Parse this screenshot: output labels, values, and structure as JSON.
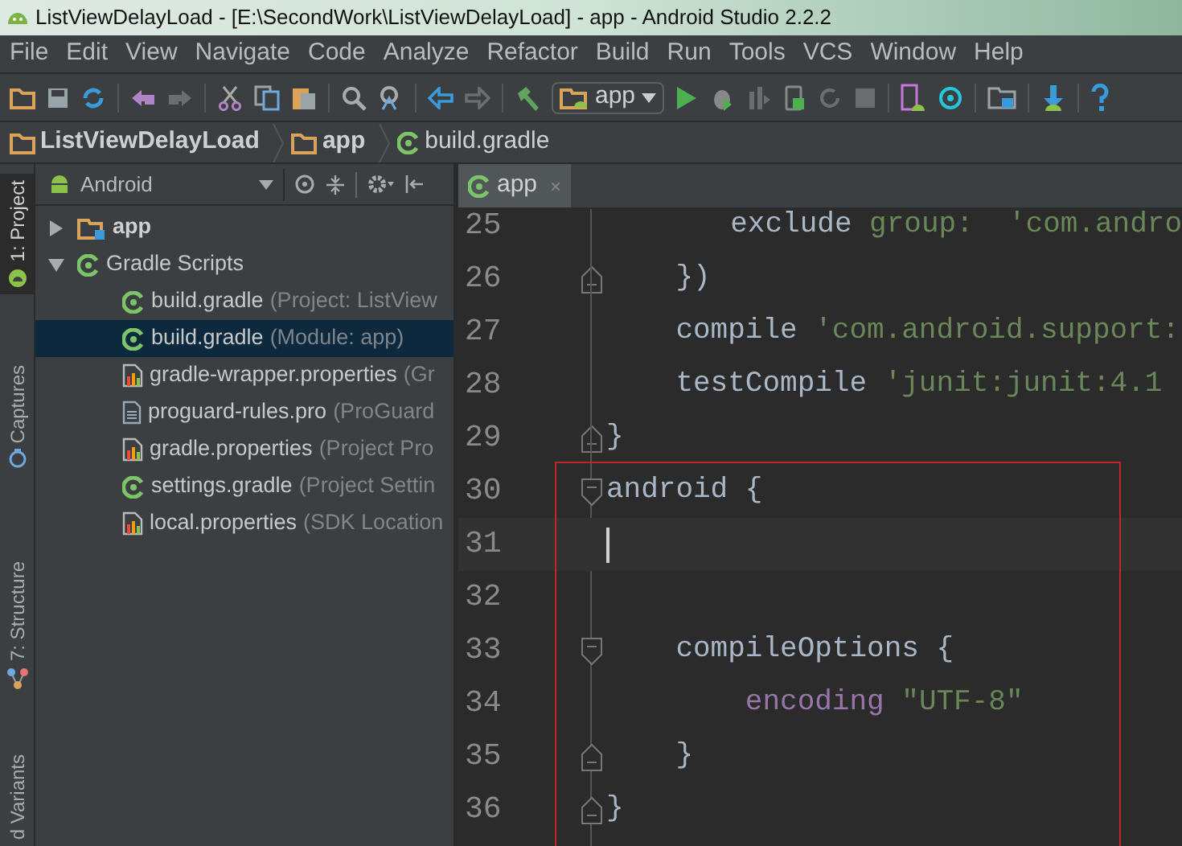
{
  "window": {
    "title": "ListViewDelayLoad - [E:\\SecondWork\\ListViewDelayLoad] - app - Android Studio 2.2.2"
  },
  "menu": [
    "File",
    "Edit",
    "View",
    "Navigate",
    "Code",
    "Analyze",
    "Refactor",
    "Build",
    "Run",
    "Tools",
    "VCS",
    "Window",
    "Help"
  ],
  "toolbar": {
    "run_configuration": "app"
  },
  "breadcrumbs": [
    {
      "label": "ListViewDelayLoad",
      "kind": "folder"
    },
    {
      "label": "app",
      "kind": "folder"
    },
    {
      "label": "build.gradle",
      "kind": "gradle"
    }
  ],
  "tool_strip": [
    {
      "label": "1: Project",
      "selected": true,
      "kind": "project"
    },
    {
      "label": "Captures",
      "selected": false,
      "kind": "captures"
    },
    {
      "label": "7: Structure",
      "selected": false,
      "kind": "structure"
    },
    {
      "label": "d Variants",
      "selected": false,
      "kind": "none"
    }
  ],
  "project_panel": {
    "view": "Android",
    "tree": [
      {
        "label": "app",
        "kind": "module",
        "expanded": false,
        "selected": false
      },
      {
        "label": "Gradle Scripts",
        "kind": "gradle",
        "expanded": true,
        "selected": false,
        "children": [
          {
            "label": "build.gradle",
            "detail": "(Project: ListView",
            "kind": "gradle",
            "selected": false
          },
          {
            "label": "build.gradle",
            "detail": "(Module: app)",
            "kind": "gradle",
            "selected": true
          },
          {
            "label": "gradle-wrapper.properties",
            "detail": "(Gr",
            "kind": "properties",
            "selected": false
          },
          {
            "label": "proguard-rules.pro",
            "detail": "(ProGuard",
            "kind": "text",
            "selected": false
          },
          {
            "label": "gradle.properties",
            "detail": "(Project Pro",
            "kind": "properties",
            "selected": false
          },
          {
            "label": "settings.gradle",
            "detail": "(Project Settin",
            "kind": "gradle",
            "selected": false
          },
          {
            "label": "local.properties",
            "detail": "(SDK Location",
            "kind": "properties",
            "selected": false
          }
        ]
      }
    ]
  },
  "editor": {
    "tabs": [
      {
        "label": "app",
        "close": "×",
        "selected": true
      }
    ],
    "lines": [
      {
        "number": "25",
        "fold_start": false,
        "fold_end": false,
        "current": false,
        "tokens": [
          {
            "text": "        exclude ",
            "kind": "plain"
          },
          {
            "text": "group: ",
            "kind": "named"
          },
          {
            "text": " 'com.andro",
            "kind": "string"
          }
        ]
      },
      {
        "number": "26",
        "fold_start": false,
        "fold_end": true,
        "current": false,
        "tokens": [
          {
            "text": "    })",
            "kind": "plain"
          }
        ]
      },
      {
        "number": "27",
        "fold_start": false,
        "fold_end": false,
        "current": false,
        "tokens": [
          {
            "text": "    compile ",
            "kind": "plain"
          },
          {
            "text": "'com.android.support:",
            "kind": "string"
          }
        ]
      },
      {
        "number": "28",
        "fold_start": false,
        "fold_end": false,
        "current": false,
        "tokens": [
          {
            "text": "    testCompile ",
            "kind": "plain"
          },
          {
            "text": "'junit:junit:4.1",
            "kind": "string"
          }
        ]
      },
      {
        "number": "29",
        "fold_start": false,
        "fold_end": true,
        "current": false,
        "tokens": [
          {
            "text": "}",
            "kind": "plain"
          }
        ]
      }
    ],
    "highlight_box": {
      "lines": [
        {
          "number": "30",
          "fold_start": true,
          "fold_end": false,
          "current": false,
          "tokens": [
            {
              "text": "android {",
              "kind": "plain"
            }
          ]
        },
        {
          "number": "31",
          "fold_start": false,
          "fold_end": false,
          "current": true
        },
        {
          "number": "32",
          "fold_start": false,
          "fold_end": false,
          "current": false
        },
        {
          "number": "33",
          "fold_start": true,
          "fold_end": false,
          "current": false,
          "tokens": [
            {
              "text": "    compileOptions {",
              "kind": "plain"
            }
          ]
        },
        {
          "number": "34",
          "fold_start": false,
          "fold_end": false,
          "current": false,
          "tokens": [
            {
              "text": "        encoding ",
              "kind": "keyword"
            },
            {
              "text": "\"UTF-8\"",
              "kind": "string"
            }
          ]
        },
        {
          "number": "35",
          "fold_start": false,
          "fold_end": true,
          "current": false,
          "tokens": [
            {
              "text": "    }",
              "kind": "plain"
            }
          ]
        },
        {
          "number": "36",
          "fold_start": false,
          "fold_end": true,
          "current": false,
          "tokens": [
            {
              "text": "}",
              "kind": "plain"
            }
          ]
        }
      ]
    }
  }
}
